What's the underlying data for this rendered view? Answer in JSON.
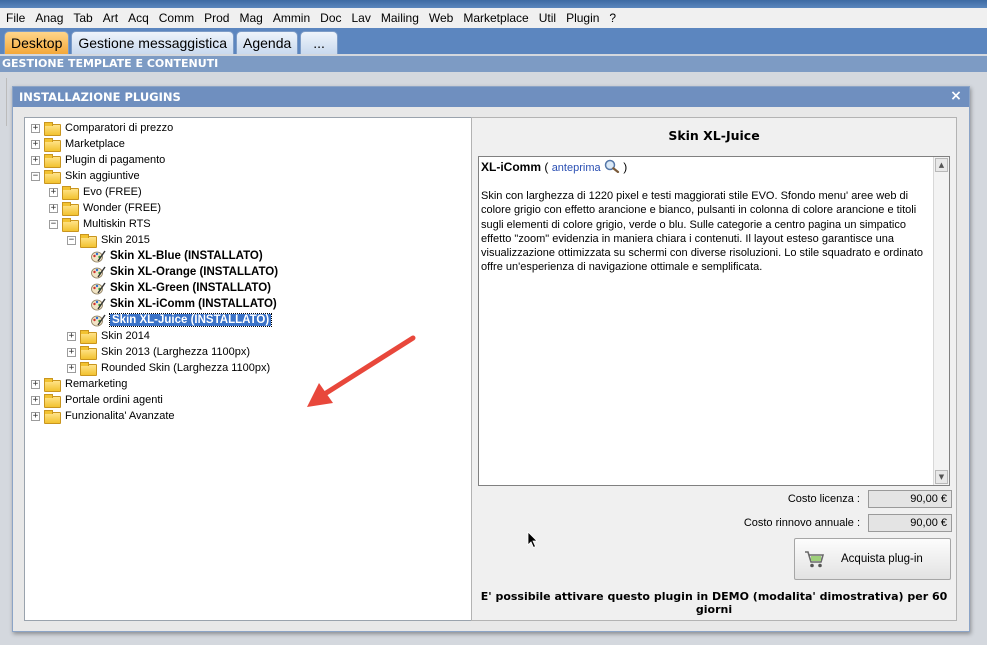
{
  "menu": [
    "File",
    "Anag",
    "Tab",
    "Art",
    "Acq",
    "Comm",
    "Prod",
    "Mag",
    "Ammin",
    "Doc",
    "Lav",
    "Mailing",
    "Web",
    "Marketplace",
    "Util",
    "Plugin",
    "?"
  ],
  "tabs": [
    {
      "label": "Desktop",
      "active": true
    },
    {
      "label": "Gestione messaggistica"
    },
    {
      "label": "Agenda"
    },
    {
      "label": "..."
    }
  ],
  "section_title": "GESTIONE TEMPLATE E CONTENUTI",
  "dialog": {
    "title": "INSTALLAZIONE PLUGINS",
    "close_glyph": "×"
  },
  "tree": [
    {
      "label": "Comparatori di prezzo",
      "level": 0,
      "exp": "+",
      "icon": "folder-icon"
    },
    {
      "label": "Marketplace",
      "level": 0,
      "exp": "+",
      "icon": "folder-icon"
    },
    {
      "label": "Plugin di pagamento",
      "level": 0,
      "exp": "+",
      "icon": "folder-icon"
    },
    {
      "label": "Skin aggiuntive",
      "level": 0,
      "exp": "−",
      "icon": "folder-icon"
    },
    {
      "label": "Evo (FREE)",
      "level": 1,
      "exp": "+",
      "icon": "folder-icon"
    },
    {
      "label": "Wonder (FREE)",
      "level": 1,
      "exp": "+",
      "icon": "folder-icon"
    },
    {
      "label": "Multiskin RTS",
      "level": 1,
      "exp": "−",
      "icon": "folder-icon"
    },
    {
      "label": "Skin 2015",
      "level": 2,
      "exp": "−",
      "icon": "folder-icon"
    },
    {
      "label": "Skin XL-Blue (INSTALLATO)",
      "level": 3,
      "icon": "skin-icon",
      "bold": true
    },
    {
      "label": "Skin XL-Orange (INSTALLATO)",
      "level": 3,
      "icon": "skin-icon",
      "bold": true
    },
    {
      "label": "Skin XL-Green (INSTALLATO)",
      "level": 3,
      "icon": "skin-icon",
      "bold": true
    },
    {
      "label": "Skin XL-iComm (INSTALLATO)",
      "level": 3,
      "icon": "skin-icon",
      "bold": true
    },
    {
      "label": "Skin XL-Juice (INSTALLATO)",
      "level": 3,
      "icon": "skin-icon",
      "bold": true,
      "selected": true
    },
    {
      "label": "Skin 2014",
      "level": 2,
      "exp": "+",
      "icon": "folder-icon"
    },
    {
      "label": "Skin 2013 (Larghezza 1100px)",
      "level": 2,
      "exp": "+",
      "icon": "folder-icon"
    },
    {
      "label": "Rounded Skin (Larghezza 1100px)",
      "level": 2,
      "exp": "+",
      "icon": "folder-icon"
    },
    {
      "label": "Remarketing",
      "level": 0,
      "exp": "+",
      "icon": "folder-icon"
    },
    {
      "label": "Portale ordini agenti",
      "level": 0,
      "exp": "+",
      "icon": "folder-icon"
    },
    {
      "label": "Funzionalita' Avanzate",
      "level": 0,
      "exp": "+",
      "icon": "folder-icon"
    }
  ],
  "detail": {
    "title": "Skin XL-Juice",
    "name": "XL-iComm",
    "paren_open": "(",
    "preview_link": "anteprima",
    "paren_close": ")",
    "description": "Skin con larghezza di 1220 pixel e testi maggiorati stile EVO. Sfondo menu' aree web di colore grigio con effetto arancione e bianco, pulsanti in colonna di colore arancione e titoli sugli elementi di colore grigio, verde o blu. Sulle categorie a centro pagina un simpatico effetto \"zoom\" evidenzia in maniera chiara i contenuti. Il layout esteso garantisce una visualizzazione ottimizzata su schermi con diverse risoluzioni. Lo stile squadrato e ordinato offre un'esperienza di navigazione ottimale e semplificata.",
    "license_label": "Costo licenza :",
    "license_value": "90,00 €",
    "renewal_label": "Costo rinnovo annuale :",
    "renewal_value": "90,00 €",
    "buy_label": "Acquista plug-in",
    "demo_note": "E' possibile attivare questo plugin in DEMO (modalita' dimostrativa) per 60 giorni"
  },
  "colors": {
    "accent": "#5c86bf",
    "selected": "#3b73c8",
    "arrow": "#e8473b",
    "link": "#2a4fb3"
  }
}
